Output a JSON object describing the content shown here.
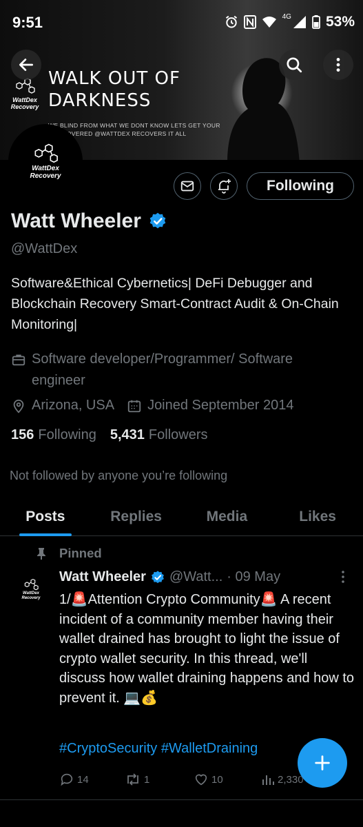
{
  "status_bar": {
    "time": "9:51",
    "network": "4G",
    "battery": "53%"
  },
  "banner": {
    "headline": "WALK OUT OF\nDARKNESS",
    "subtext": "WE BLIND FROM WHAT WE DONT KNOW LETS GET YOUR\nT RECOVERED @WATTDEX RECOVERS IT ALL",
    "logo_text": "WattDex\nRecovery"
  },
  "profile": {
    "avatar_text": "WattDex\nRecovery",
    "display_name": "Watt Wheeler",
    "verified": true,
    "handle": "@WattDex",
    "bio": "Software&Ethical Cybernetics| DeFi Debugger and Blockchain Recovery Smart-Contract Audit & On-Chain Monitoring|",
    "category": "Software developer/Programmer/ Software engineer",
    "location": "Arizona, USA",
    "joined": "Joined September 2014",
    "following_count": "156",
    "following_label": "Following",
    "followers_count": "5,431",
    "followers_label": "Followers",
    "not_followed_text": "Not followed by anyone you’re following"
  },
  "actions": {
    "following_button": "Following",
    "icons": [
      "back-arrow-icon",
      "search-icon",
      "more-vertical-icon",
      "mail-icon",
      "bell-plus-icon"
    ]
  },
  "tabs": [
    {
      "label": "Posts",
      "active": true
    },
    {
      "label": "Replies",
      "active": false
    },
    {
      "label": "Media",
      "active": false
    },
    {
      "label": "Likes",
      "active": false
    }
  ],
  "tweet": {
    "pinned_label": "Pinned",
    "avatar_text": "WattDex\nRecovery",
    "name": "Watt Wheeler",
    "handle_truncated": "@Watt...",
    "date": "· 09 May",
    "text": "1/🚨Attention Crypto Community🚨 A recent incident of a community member having their wallet drained has brought to light the issue of crypto wallet security. In this thread, we'll discuss how wallet draining happens and how to prevent it. 💻💰",
    "hashtags": "#CryptoSecurity #WalletDraining",
    "replies": "14",
    "reposts": "1",
    "likes": "10",
    "views": "2,330"
  },
  "colors": {
    "background": "#000000",
    "accent": "#1d9bf0",
    "text_primary": "#e7e9ea",
    "text_secondary": "#71767b",
    "border": "#2f3336"
  }
}
